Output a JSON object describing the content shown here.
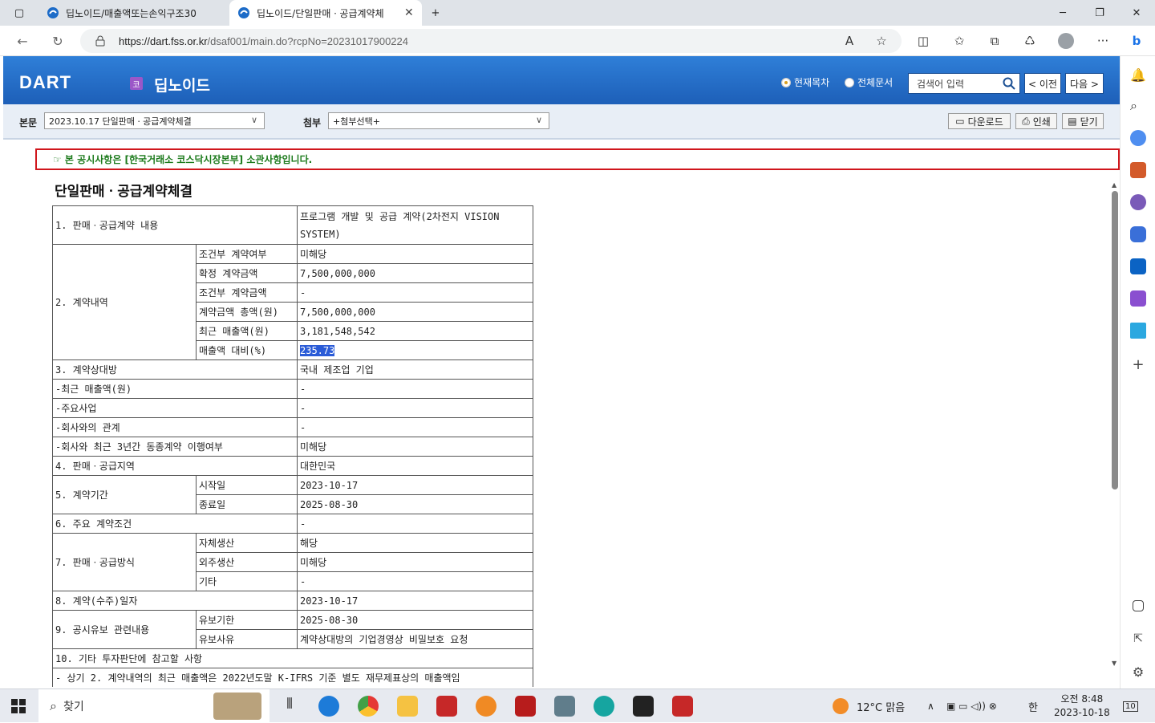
{
  "browser": {
    "tabs": [
      {
        "title": "딥노이드/매출액또는손익구조30"
      },
      {
        "title": "딥노이드/단일판매ㆍ공급계약체"
      }
    ],
    "url_host": "https://dart.fss.or.kr",
    "url_path": "/dsaf001/main.do?rcpNo=20231017900224",
    "new_tab": "+",
    "min": "─",
    "max": "❐",
    "close": "✕"
  },
  "header": {
    "logo": "DART",
    "corp_badge": "코",
    "corp_name": "딥노이드",
    "radio_current": "현재목차",
    "radio_all": "전체문서",
    "search_placeholder": "검색어 입력",
    "prev": "< 이전",
    "next": "다음 >"
  },
  "subbar": {
    "main_label": "본문",
    "main_select": "2023.10.17  단일판매ㆍ공급계약체결",
    "attach_label": "첨부",
    "attach_select": "+첨부선택+",
    "download": "다운로드",
    "print": "인쇄",
    "close": "닫기"
  },
  "notice": "☞ 본 공시사항은 [한국거래소 코스닥시장본부] 소관사항입니다.",
  "doc_title": "단일판매ㆍ공급계약체결",
  "table": {
    "r1_label": "1. 판매ㆍ공급계약 내용",
    "r1_val": "프로그램 개발 및 공급 계약(2차전지 VISION",
    "r1_val2": "SYSTEM)",
    "r2_label": "2. 계약내역",
    "r2_rows": [
      {
        "k": "조건부 계약여부",
        "v": "미해당"
      },
      {
        "k": "확정 계약금액",
        "v": "7,500,000,000"
      },
      {
        "k": "조건부 계약금액",
        "v": "-"
      },
      {
        "k": "계약금액 총액(원)",
        "v": "7,500,000,000"
      },
      {
        "k": "최근 매출액(원)",
        "v": "3,181,548,542"
      },
      {
        "k": "매출액 대비(%)",
        "v": "235.73"
      }
    ],
    "r3_label": "3. 계약상대방",
    "r3_val": "국내 제조업 기업",
    "r3a_label": "-최근 매출액(원)",
    "r3a_val": "-",
    "r3b_label": "-주요사업",
    "r3b_val": "-",
    "r3c_label": "-회사와의 관계",
    "r3c_val": "-",
    "r3d_label": "-회사와 최근 3년간 동종계약 이행여부",
    "r3d_val": "미해당",
    "r4_label": "4. 판매ㆍ공급지역",
    "r4_val": "대한민국",
    "r5_label": "5. 계약기간",
    "r5_start_k": "시작일",
    "r5_start_v": "2023-10-17",
    "r5_end_k": "종료일",
    "r5_end_v": "2025-08-30",
    "r6_label": "6. 주요 계약조건",
    "r6_val": "-",
    "r7_label": "7. 판매ㆍ공급방식",
    "r7a_k": "자체생산",
    "r7a_v": "해당",
    "r7b_k": "외주생산",
    "r7b_v": "미해당",
    "r7c_k": "기타",
    "r7c_v": "-",
    "r8_label": "8. 계약(수주)일자",
    "r8_val": "2023-10-17",
    "r9_label": "9. 공시유보 관련내용",
    "r9a_k": "유보기한",
    "r9a_v": "2025-08-30",
    "r9b_k": "유보사유",
    "r9b_v": "계약상대방의 기업경영상 비밀보호 요청",
    "r10_label": "10. 기타 투자판단에 참고할 사항",
    "r10_cut": "- 상기 2. 계약내역의 최근 매출액은 2022년도말 K-IFRS 기준 별도 재무제표상의 매출액임"
  },
  "taskbar": {
    "search": "찾기",
    "weather": "12°C  맑음",
    "ime": "한",
    "time": "오전 8:48",
    "date": "2023-10-18",
    "notif": "10"
  }
}
